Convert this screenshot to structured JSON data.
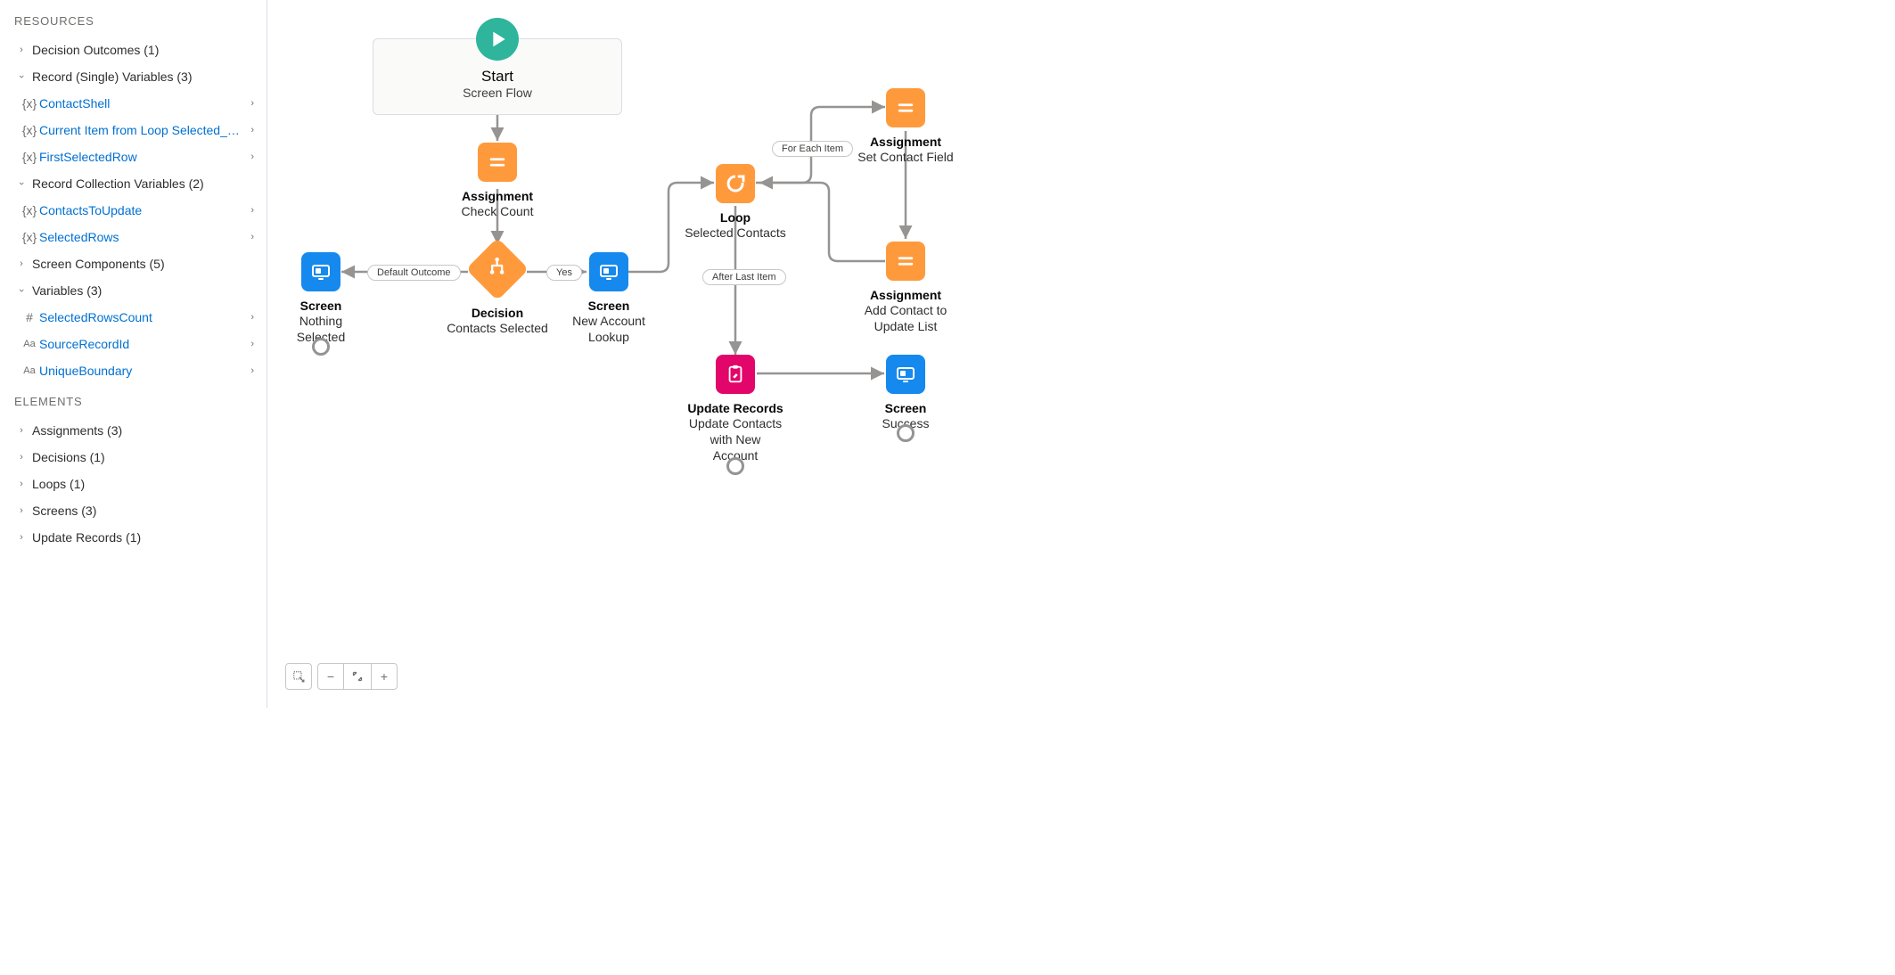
{
  "sidebar": {
    "resources_header": "RESOURCES",
    "elements_header": "ELEMENTS",
    "decision_outcomes": "Decision Outcomes (1)",
    "record_single_vars": "Record (Single) Variables (3)",
    "contact_shell": "ContactShell",
    "current_item": "Current Item from Loop Selected_Co…",
    "first_selected_row": "FirstSelectedRow",
    "record_collection_vars": "Record Collection Variables (2)",
    "contacts_to_update": "ContactsToUpdate",
    "selected_rows": "SelectedRows",
    "screen_components": "Screen Components (5)",
    "variables": "Variables (3)",
    "selected_rows_count": "SelectedRowsCount",
    "source_record_id": "SourceRecordId",
    "unique_boundary": "UniqueBoundary",
    "assignments": "Assignments (3)",
    "decisions": "Decisions (1)",
    "loops": "Loops (1)",
    "screens": "Screens (3)",
    "update_records": "Update Records (1)"
  },
  "canvas": {
    "start_title": "Start",
    "start_sub": "Screen Flow",
    "check_count_title": "Assignment",
    "check_count_sub": "Check Count",
    "decision_title": "Decision",
    "decision_sub": "Contacts Selected",
    "nothing_title": "Screen",
    "nothing_sub": "Nothing Selected",
    "newacct_title": "Screen",
    "newacct_sub1": "New Account",
    "newacct_sub2": "Lookup",
    "loop_title": "Loop",
    "loop_sub": "Selected Contacts",
    "set_field_title": "Assignment",
    "set_field_sub": "Set Contact Field",
    "add_list_title": "Assignment",
    "add_list_sub1": "Add Contact to",
    "add_list_sub2": "Update List",
    "update_title": "Update Records",
    "update_sub1": "Update Contacts",
    "update_sub2": "with New Account",
    "success_title": "Screen",
    "success_sub": "Success",
    "pill_default": "Default Outcome",
    "pill_yes": "Yes",
    "pill_foreach": "For Each Item",
    "pill_afterlast": "After Last Item"
  }
}
